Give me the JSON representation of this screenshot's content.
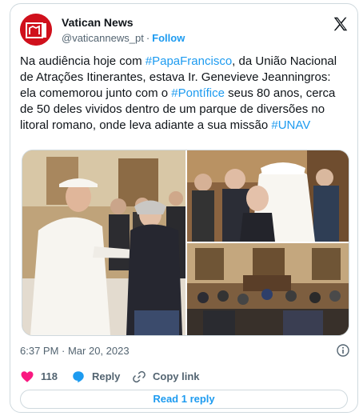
{
  "author": {
    "display_name": "Vatican News",
    "handle": "@vaticannews_pt",
    "follow_label": "Follow",
    "avatar_icon": "vatican-news-logo-icon",
    "brand_color": "#d0101c"
  },
  "tweet": {
    "seg1": "Na audiência hoje com ",
    "tag1": "#PapaFrancisco",
    "seg2": ", da União Nacional de Atrações Itinerantes, estava Ir. Genevieve Jeanningros: ela comemorou junto com o ",
    "tag2": "#Pontífice",
    "seg3": " seus 80 anos, cerca de 50 deles vividos dentro de um parque de diversões no litoral romano, onde leva adiante a sua missão ",
    "tag3": "#UNAV",
    "link_color": "#1d9bf0"
  },
  "meta": {
    "timestamp": "6:37 PM · Mar 20, 2023"
  },
  "actions": {
    "likes_count": "118",
    "reply_label": "Reply",
    "copy_link_label": "Copy link",
    "like_color": "#f91880"
  },
  "footer": {
    "read_replies_label": "Read 1 reply"
  }
}
